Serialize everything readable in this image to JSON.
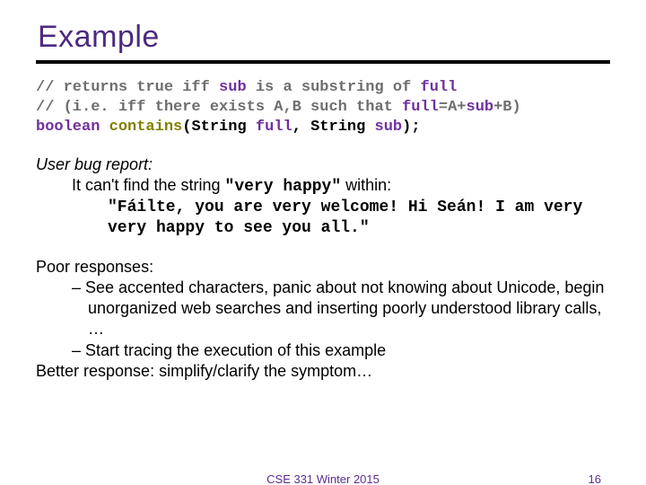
{
  "title": "Example",
  "code": {
    "comment1_a": "// returns true iff ",
    "comment1_kw": "sub",
    "comment1_b": " is a substring of ",
    "comment1_kw2": "full",
    "comment2_a": "// (i.e. iff there exists A,B such that ",
    "comment2_kw": "full",
    "comment2_b": "=A+",
    "comment2_kw2": "sub",
    "comment2_c": "+B)",
    "sig_kw1": "boolean ",
    "sig_fn": "contains",
    "sig_mid1": "(String ",
    "sig_arg1": "full",
    "sig_mid2": ", String ",
    "sig_arg2": "sub",
    "sig_end": ");"
  },
  "bugreport": {
    "label": "User bug report:",
    "line1_a": "It can't find the string ",
    "line1_code": "\"very happy\"",
    "line1_b": " within:",
    "quoted": "\"Fáilte, you are very welcome! Hi Seán! I am very very happy to see you all.\""
  },
  "responses": {
    "poor_label": "Poor responses:",
    "poor1": "See accented characters, panic about not knowing about Unicode, begin unorganized web searches and inserting poorly understood library calls, …",
    "poor2": "Start tracing the execution of this example",
    "better_label": "Better response",
    "better_text": ": simplify/clarify the symptom…",
    "dash": "– "
  },
  "footer": {
    "course": "CSE 331 Winter 2015",
    "page": "16"
  }
}
